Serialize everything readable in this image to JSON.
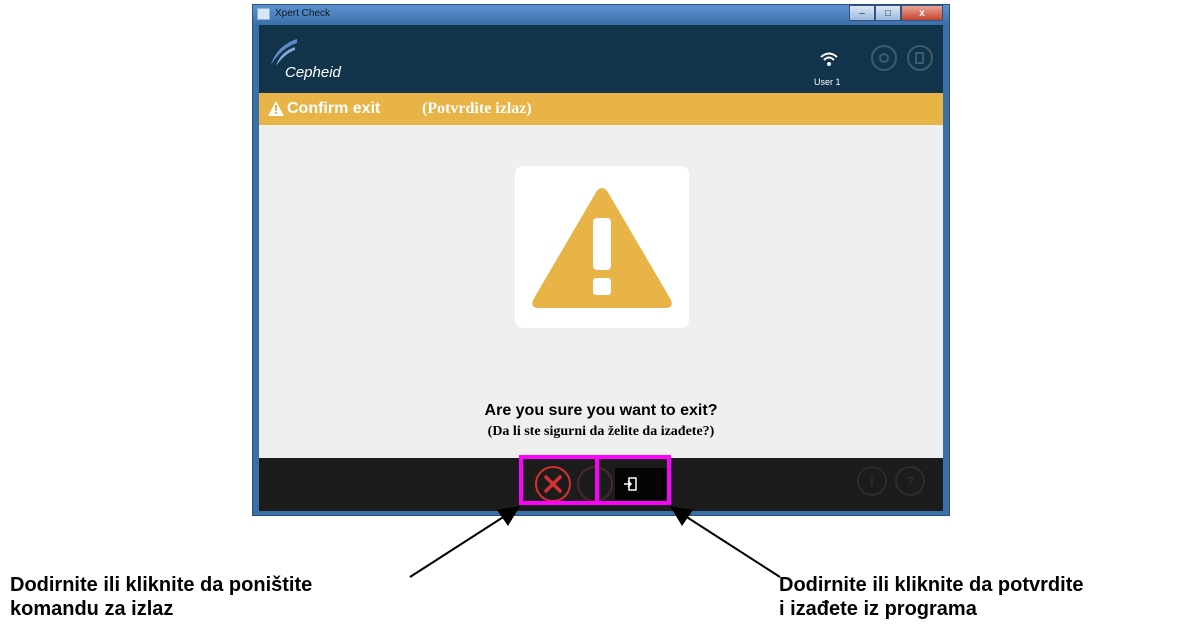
{
  "window": {
    "title": "Xpert Check",
    "controls": {
      "minimize": "–",
      "maximize": "□",
      "close": "x"
    }
  },
  "header": {
    "brand": "Cepheid",
    "user": "User 1",
    "icons": [
      "wifi-icon",
      "gear-person-icon",
      "exit-icon"
    ]
  },
  "banner": {
    "title": "Confirm exit",
    "subtitle": "(Potvrdite izlaz)",
    "color": "#e8b347"
  },
  "dialog": {
    "question": "Are you sure you want to exit?",
    "question_translation": "(Da li ste sigurni da želite da izađete?)",
    "icon": "warning-triangle-icon"
  },
  "footer": {
    "buttons": [
      "cancel-button",
      "exit-confirm-button",
      "info-button",
      "help-button"
    ],
    "info_glyph": "i",
    "help_glyph": "?"
  },
  "callouts": {
    "left": [
      "Dodirnite ili kliknite da poništite",
      "komandu za izlaz"
    ],
    "right": [
      "Dodirnite ili kliknite da potvrdite",
      "i izađete iz programa"
    ]
  },
  "colors": {
    "header": "#12344a",
    "accent": "#e8b347",
    "highlight": "#ff00ff",
    "cancel": "#d83030"
  }
}
